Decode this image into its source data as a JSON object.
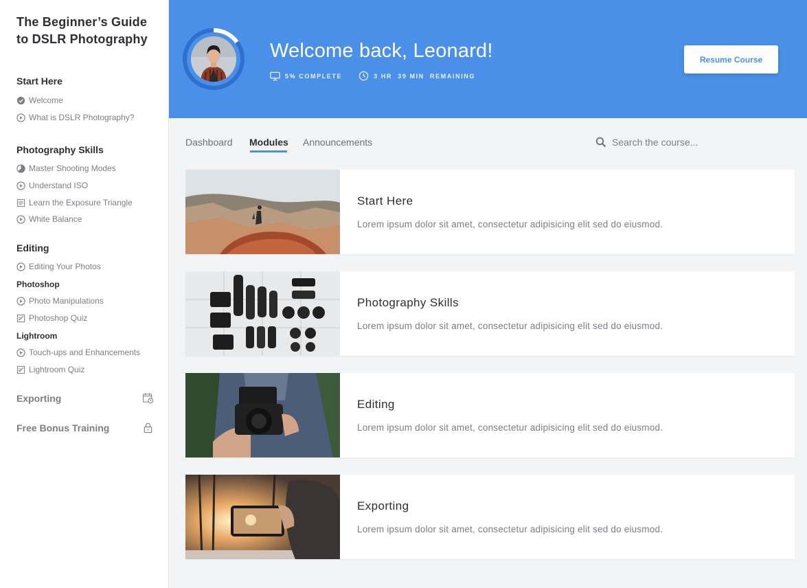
{
  "sidebar": {
    "course_title": "The Beginner’s Guide to DSLR Photography",
    "sections": [
      {
        "title": "Start Here",
        "lessons": [
          "Welcome",
          "What is DSLR Photography?"
        ]
      },
      {
        "title": "Photography Skills",
        "lessons": [
          "Master Shooting Modes",
          "Understand ISO",
          "Learn the Exposure Triangle",
          "White Balance"
        ]
      },
      {
        "title": "Editing",
        "lessons": [
          "Editing Your Photos"
        ],
        "subsections": [
          {
            "title": "Photoshop",
            "lessons": [
              "Photo Manipulations",
              "Photoshop Quiz"
            ]
          },
          {
            "title": "Lightroom",
            "lessons": [
              "Touch-ups and Enhancements",
              "Lightroom Quiz"
            ]
          }
        ]
      },
      {
        "title": "Exporting",
        "icon": "calendar-clock-icon"
      },
      {
        "title": "Free Bonus Training",
        "icon": "lock-icon"
      }
    ]
  },
  "header": {
    "welcome": "Welcome back, Leonard!",
    "progress_fraction": 0.05,
    "progress_text": "5% COMPLETE",
    "time_text": "3 HR  39 MIN  REMAINING",
    "resume_label": "Resume Course",
    "accent": "#4a8fe8"
  },
  "tabs": [
    "Dashboard",
    "Modules",
    "Announcements"
  ],
  "active_tab": "Modules",
  "search": {
    "placeholder": "Search the course..."
  },
  "modules": [
    {
      "title": "Start Here",
      "description": "Lorem ipsum dolor sit amet, consectetur adipisicing elit sed do eiusmod."
    },
    {
      "title": "Photography Skills",
      "description": "Lorem ipsum dolor sit amet, consectetur adipisicing elit sed do eiusmod."
    },
    {
      "title": "Editing",
      "description": "Lorem ipsum dolor sit amet, consectetur adipisicing elit sed do eiusmod."
    },
    {
      "title": "Exporting",
      "description": "Lorem ipsum dolor sit amet, consectetur adipisicing elit sed do eiusmod."
    }
  ]
}
